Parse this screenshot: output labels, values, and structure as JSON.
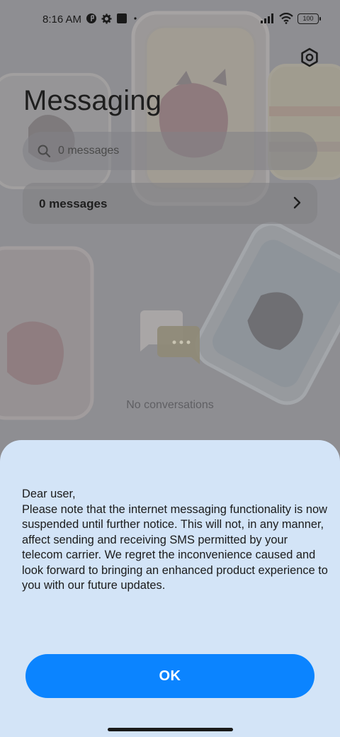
{
  "status_bar": {
    "time": "8:16 AM",
    "battery": "100",
    "icons_left": [
      "vpn-icon",
      "gear-icon",
      "app-icon",
      "dot-icon"
    ],
    "icons_right": [
      "signal-icon",
      "wifi-icon",
      "battery-icon"
    ]
  },
  "header": {
    "title": "Messaging",
    "settings_icon": "settings-hexagon-icon"
  },
  "search": {
    "placeholder": "0 messages"
  },
  "message_row": {
    "label": "0 messages"
  },
  "empty_state": {
    "text": "No conversations",
    "icon": "chat-bubbles-icon"
  },
  "dialog": {
    "lines": [
      "Dear user,",
      "Please note that the internet messaging functionality is now suspended until further notice. This will not, in any manner, affect sending and receiving SMS permitted by your telecom carrier. We regret the inconvenience caused and look forward to bringing an enhanced product experience to you with our future updates."
    ],
    "ok_label": "OK"
  },
  "colors": {
    "sheet_bg": "#d3e4f7",
    "button_bg": "#0b84ff",
    "scrim_bg": "#8e8e92"
  }
}
